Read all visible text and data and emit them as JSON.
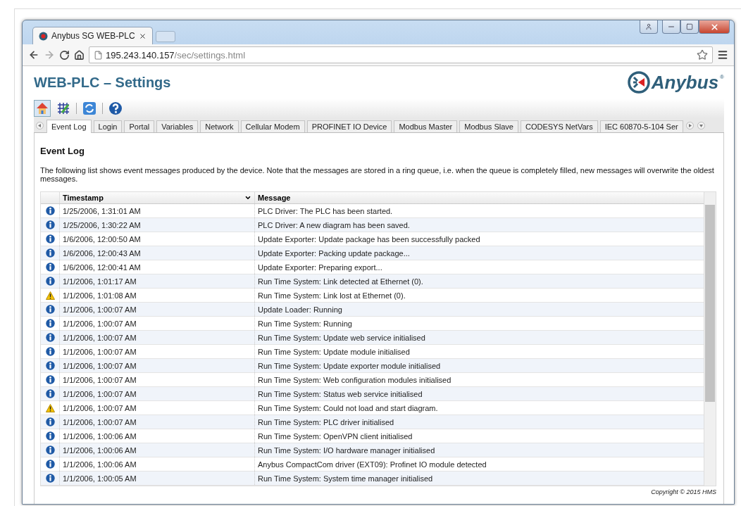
{
  "browser": {
    "tab_title": "Anybus SG WEB-PLC",
    "url_host": "195.243.140.157",
    "url_path": "/sec/settings.html"
  },
  "page": {
    "title": "WEB-PLC – Settings",
    "logo_text": "Anybus",
    "logo_mark": "®"
  },
  "tabs": [
    {
      "label": "Event Log",
      "selected": true
    },
    {
      "label": "Login",
      "selected": false
    },
    {
      "label": "Portal",
      "selected": false
    },
    {
      "label": "Variables",
      "selected": false
    },
    {
      "label": "Network",
      "selected": false
    },
    {
      "label": "Cellular Modem",
      "selected": false
    },
    {
      "label": "PROFINET IO Device",
      "selected": false
    },
    {
      "label": "Modbus Master",
      "selected": false
    },
    {
      "label": "Modbus Slave",
      "selected": false
    },
    {
      "label": "CODESYS NetVars",
      "selected": false
    },
    {
      "label": "IEC 60870-5-104 Ser",
      "selected": false
    }
  ],
  "section": {
    "heading": "Event Log",
    "description": "The following list shows event messages produced by the device. Note that the messages are stored in a ring queue, i.e. when the queue is completely filled, new messages will overwrite the oldest messages."
  },
  "table": {
    "columns": [
      "Timestamp",
      "Message"
    ],
    "rows": [
      {
        "kind": "info",
        "timestamp": "1/25/2006, 1:31:01 AM",
        "message": "PLC Driver: The PLC has been started."
      },
      {
        "kind": "info",
        "timestamp": "1/25/2006, 1:30:22 AM",
        "message": "PLC Driver: A new diagram has been saved."
      },
      {
        "kind": "info",
        "timestamp": "1/6/2006, 12:00:50 AM",
        "message": "Update Exporter: Update package has been successfully packed"
      },
      {
        "kind": "info",
        "timestamp": "1/6/2006, 12:00:43 AM",
        "message": "Update Exporter: Packing update package..."
      },
      {
        "kind": "info",
        "timestamp": "1/6/2006, 12:00:41 AM",
        "message": "Update Exporter: Preparing export..."
      },
      {
        "kind": "info",
        "timestamp": "1/1/2006, 1:01:17 AM",
        "message": "Run Time System: Link detected at Ethernet (0)."
      },
      {
        "kind": "warning",
        "timestamp": "1/1/2006, 1:01:08 AM",
        "message": "Run Time System: Link lost at Ethernet (0)."
      },
      {
        "kind": "info",
        "timestamp": "1/1/2006, 1:00:07 AM",
        "message": "Update Loader: Running"
      },
      {
        "kind": "info",
        "timestamp": "1/1/2006, 1:00:07 AM",
        "message": "Run Time System: Running"
      },
      {
        "kind": "info",
        "timestamp": "1/1/2006, 1:00:07 AM",
        "message": "Run Time System: Update web service initialised"
      },
      {
        "kind": "info",
        "timestamp": "1/1/2006, 1:00:07 AM",
        "message": "Run Time System: Update module initialised"
      },
      {
        "kind": "info",
        "timestamp": "1/1/2006, 1:00:07 AM",
        "message": "Run Time System: Update exporter module initialised"
      },
      {
        "kind": "info",
        "timestamp": "1/1/2006, 1:00:07 AM",
        "message": "Run Time System: Web configuration modules initialised"
      },
      {
        "kind": "info",
        "timestamp": "1/1/2006, 1:00:07 AM",
        "message": "Run Time System: Status web service initialised"
      },
      {
        "kind": "warning",
        "timestamp": "1/1/2006, 1:00:07 AM",
        "message": "Run Time System: Could not load and start diagram."
      },
      {
        "kind": "info",
        "timestamp": "1/1/2006, 1:00:07 AM",
        "message": "Run Time System: PLC driver initialised"
      },
      {
        "kind": "info",
        "timestamp": "1/1/2006, 1:00:06 AM",
        "message": "Run Time System: OpenVPN client initialised"
      },
      {
        "kind": "info",
        "timestamp": "1/1/2006, 1:00:06 AM",
        "message": "Run Time System: I/O hardware manager initialised"
      },
      {
        "kind": "info",
        "timestamp": "1/1/2006, 1:00:06 AM",
        "message": "Anybus CompactCom driver (EXT09): Profinet IO module detected"
      },
      {
        "kind": "info",
        "timestamp": "1/1/2006, 1:00:05 AM",
        "message": "Run Time System: System time manager initialised"
      }
    ]
  },
  "footer": {
    "copyright": "Copyright © 2015 HMS"
  }
}
